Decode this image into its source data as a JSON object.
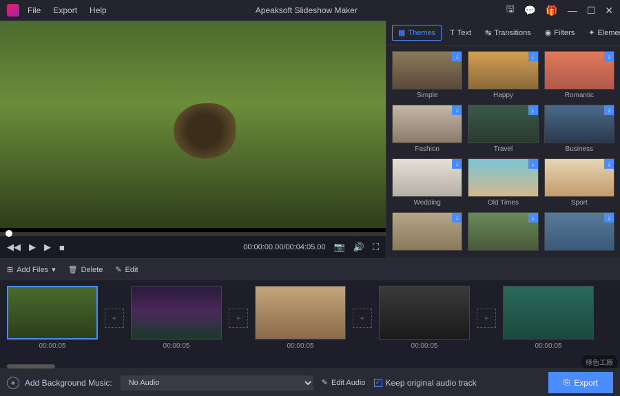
{
  "app": {
    "title": "Apeaksoft Slideshow Maker"
  },
  "menu": {
    "file": "File",
    "export": "Export",
    "help": "Help"
  },
  "player": {
    "time": "00:00:00.00/00:04:05.00"
  },
  "tabs": {
    "themes": "Themes",
    "text": "Text",
    "transitions": "Transitions",
    "filters": "Filters",
    "elements": "Elements"
  },
  "themes": [
    {
      "label": "Simple",
      "bg": "linear-gradient(#8a7a5a,#5a4a3a)"
    },
    {
      "label": "Happy",
      "bg": "linear-gradient(#d4a055,#8a6a3a)"
    },
    {
      "label": "Romantic",
      "bg": "linear-gradient(#e07a5a,#b05a4a)"
    },
    {
      "label": "Fashion",
      "bg": "linear-gradient(#c5b8a5,#8a7a6a)"
    },
    {
      "label": "Travel",
      "bg": "linear-gradient(#3a5a4a,#2a3a2e)"
    },
    {
      "label": "Business",
      "bg": "linear-gradient(#4a6a8a,#2a3a4e)"
    },
    {
      "label": "Wedding",
      "bg": "linear-gradient(#e5e0d5,#b5b0a5)"
    },
    {
      "label": "Old Times",
      "bg": "linear-gradient(#7ac5d5,#d5b88a)"
    },
    {
      "label": "Sport",
      "bg": "linear-gradient(#e5d5b5,#c59a6a)"
    },
    {
      "label": "",
      "bg": "linear-gradient(#b5a58a,#8a7a5a)"
    },
    {
      "label": "",
      "bg": "linear-gradient(#6a8a5a,#4a5a3a)"
    },
    {
      "label": "",
      "bg": "linear-gradient(#5a7a9a,#3a5a7a)"
    }
  ],
  "toolbar": {
    "add": "Add Files",
    "delete": "Delete",
    "edit": "Edit"
  },
  "clips": [
    {
      "time": "00:00:05",
      "bg": "linear-gradient(#4a6b2e,#2e3d1a)",
      "sel": true
    },
    {
      "time": "00:00:05",
      "bg": "linear-gradient(#2a1a3a,#4a2a5a,#1a3a2a)"
    },
    {
      "time": "00:00:05",
      "bg": "linear-gradient(#c5a57a,#8a6a4a)"
    },
    {
      "time": "00:00:05",
      "bg": "linear-gradient(#3a3a3a,#1a1a1a)"
    },
    {
      "time": "00:00:05",
      "bg": "linear-gradient(#2a6a5a,#1a4a3e)"
    }
  ],
  "footer": {
    "bgm_label": "Add Background Music:",
    "audio_sel": "No Audio",
    "edit_audio": "Edit Audio",
    "keep_track": "Keep original audio track",
    "export": "Export"
  },
  "watermark": "綠色工廠"
}
